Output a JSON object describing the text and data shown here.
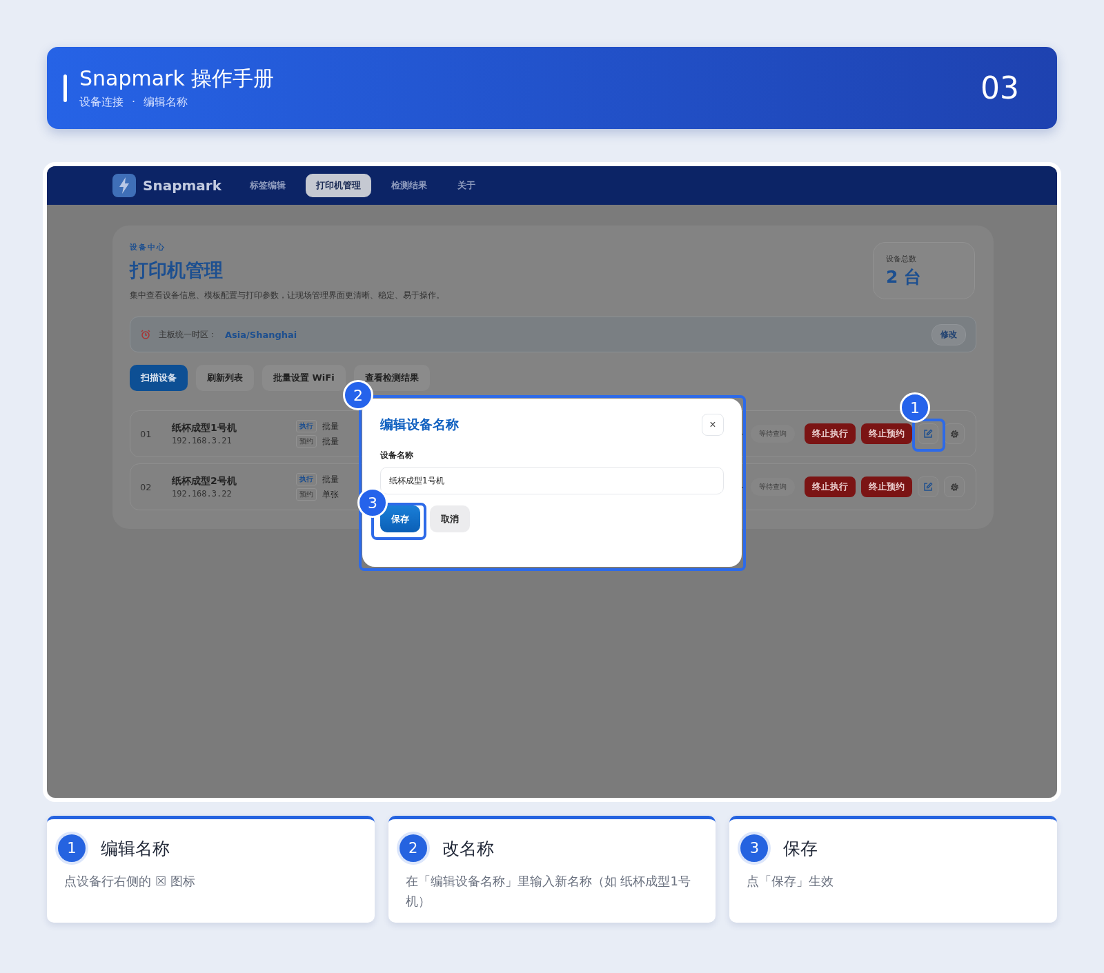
{
  "manual_header": {
    "title": "Snapmark 操作手册",
    "breadcrumb": [
      "设备连接",
      "编辑名称"
    ],
    "separator": "·",
    "page_number": "03"
  },
  "app": {
    "brand": "Snapmark",
    "nav_tabs": [
      {
        "label": "标签编辑",
        "selected": false
      },
      {
        "label": "打印机管理",
        "selected": true
      },
      {
        "label": "检测结果",
        "selected": false
      },
      {
        "label": "关于",
        "selected": false
      }
    ],
    "page": {
      "eyebrow": "设备中心",
      "title": "打印机管理",
      "description": "集中查看设备信息、模板配置与打印参数，让现场管理界面更清晰、稳定、易于操作。",
      "stat": {
        "label": "设备总数",
        "value": "2 台"
      }
    },
    "timezone": {
      "label": "主板统一时区：",
      "value": "Asia/Shanghai",
      "button": "修改"
    },
    "toolbar": [
      {
        "label": "扫描设备",
        "kind": "primary"
      },
      {
        "label": "刷新列表",
        "kind": "secondary"
      },
      {
        "label": "批量设置 WiFi",
        "kind": "secondary"
      },
      {
        "label": "查看检测结果",
        "kind": "secondary"
      }
    ],
    "devices": [
      {
        "index": "01",
        "name": "纸杯成型1号机",
        "ip": "192.168.3.21",
        "modes": [
          {
            "tag": "执行",
            "value": "批量",
            "active": true
          },
          {
            "tag": "预约",
            "value": "批量",
            "active": false
          }
        ],
        "status": "等待查询",
        "actions": [
          "终止执行",
          "终止预约"
        ]
      },
      {
        "index": "02",
        "name": "纸杯成型2号机",
        "ip": "192.168.3.22",
        "modes": [
          {
            "tag": "执行",
            "value": "批量",
            "active": true
          },
          {
            "tag": "预约",
            "value": "单张",
            "active": false
          }
        ],
        "status": "等待查询",
        "actions": [
          "终止执行",
          "终止预约"
        ]
      }
    ],
    "dialog": {
      "title": "编辑设备名称",
      "close": "×",
      "field_label": "设备名称",
      "field_value": "纸杯成型1号机",
      "buttons": [
        {
          "label": "保存",
          "kind": "primary"
        },
        {
          "label": "取消",
          "kind": "secondary"
        }
      ]
    },
    "callouts": [
      "1",
      "2",
      "3"
    ]
  },
  "steps": [
    {
      "number": "1",
      "title": "编辑名称",
      "description": "点设备行右侧的 ☒ 图标"
    },
    {
      "number": "2",
      "title": "改名称",
      "description": "在「编辑设备名称」里输入新名称（如 纸杯成型1号机）"
    },
    {
      "number": "3",
      "title": "保存",
      "description": "点「保存」生效"
    }
  ]
}
